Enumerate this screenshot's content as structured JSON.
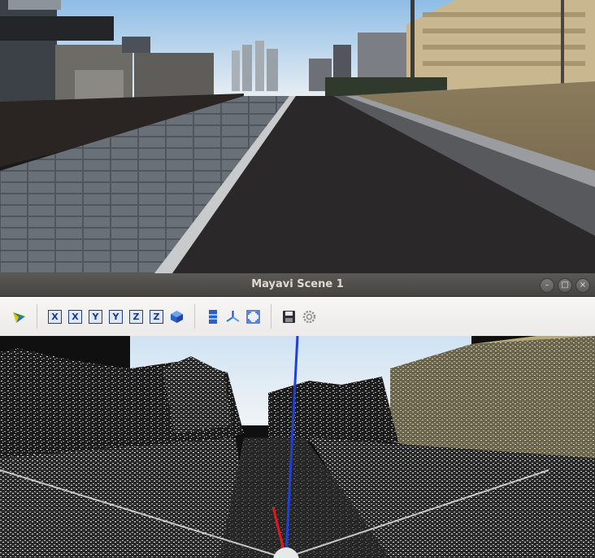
{
  "window": {
    "title": "Mayavi Scene 1",
    "controls": {
      "minimize": "–",
      "maximize": "□",
      "close": "×"
    }
  },
  "toolbar": {
    "items": [
      {
        "icon": "mayavi-logo-icon"
      },
      {
        "label": "X",
        "icon": "view-x-positive-icon"
      },
      {
        "label": "X",
        "icon": "view-x-negative-icon"
      },
      {
        "label": "Y",
        "icon": "view-y-positive-icon"
      },
      {
        "label": "Y",
        "icon": "view-y-negative-icon"
      },
      {
        "label": "Z",
        "icon": "view-z-positive-icon"
      },
      {
        "label": "Z",
        "icon": "view-z-negative-icon"
      },
      {
        "icon": "isometric-view-icon"
      },
      {
        "icon": "parallel-projection-icon"
      },
      {
        "icon": "show-axes-icon"
      },
      {
        "icon": "full-screen-icon"
      },
      {
        "icon": "save-icon"
      },
      {
        "icon": "settings-icon"
      }
    ]
  },
  "colors": {
    "titlebar": "#4e4d49",
    "toolbar_bg": "#efeeec",
    "axis_z": "#1f3fd6",
    "axis_x": "#e01a1a",
    "sky": "#bcd8ef",
    "road": "#2b2829"
  }
}
